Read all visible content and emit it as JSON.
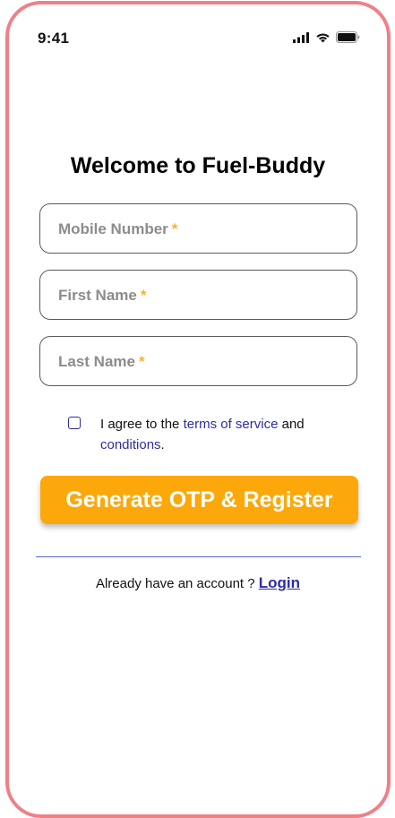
{
  "status_bar": {
    "time": "9:41",
    "icons": [
      "signal-icon",
      "wifi-icon",
      "battery-icon"
    ]
  },
  "title": "Welcome to Fuel-Buddy",
  "fields": [
    {
      "label": "Mobile Number",
      "required_mark": "*"
    },
    {
      "label": "First Name",
      "required_mark": "*"
    },
    {
      "label": "Last Name",
      "required_mark": "*"
    }
  ],
  "agreement": {
    "checked": false,
    "prefix": "I agree to the ",
    "terms_link": "terms of service",
    "middle": " and ",
    "conditions_link": "conditions",
    "suffix": "."
  },
  "cta_label": "Generate OTP & Register",
  "login_prompt": {
    "text": "Already have an account ? ",
    "link": "Login"
  },
  "colors": {
    "frame": "#f07f86",
    "accent": "#fca80a",
    "link": "#2d2da4",
    "required": "#f5b335",
    "divider": "#5b62c8"
  }
}
